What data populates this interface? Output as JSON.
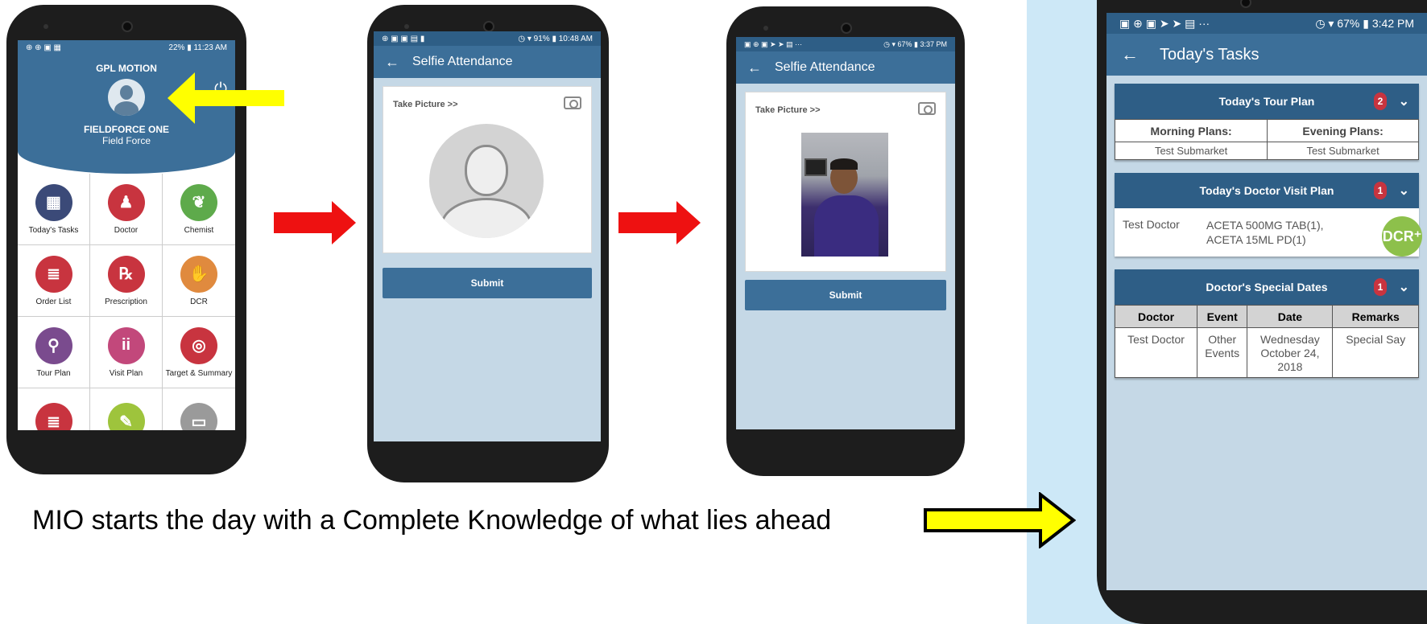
{
  "phone1": {
    "status_time": "11:23 AM",
    "status_battery": "22%",
    "app_title": "GPL MOTION",
    "user_name": "FIELDFORCE ONE",
    "user_role": "Field Force",
    "tiles": [
      {
        "label": "Today's Tasks",
        "icon": "calendar-icon",
        "color": "#3b4a78",
        "glyph": "▦"
      },
      {
        "label": "Doctor",
        "icon": "doctor-icon",
        "color": "#c8343f",
        "glyph": "♟"
      },
      {
        "label": "Chemist",
        "icon": "mortar-icon",
        "color": "#5eaa4b",
        "glyph": "❦"
      },
      {
        "label": "Order List",
        "icon": "order-list-icon",
        "color": "#c8343f",
        "glyph": "≣"
      },
      {
        "label": "Prescription",
        "icon": "prescription-icon",
        "color": "#c8343f",
        "glyph": "℞"
      },
      {
        "label": "DCR",
        "icon": "dcr-icon",
        "color": "#e08a3e",
        "glyph": "✋"
      },
      {
        "label": "Tour Plan",
        "icon": "map-pin-icon",
        "color": "#7a4b8e",
        "glyph": "⚲"
      },
      {
        "label": "Visit Plan",
        "icon": "visit-plan-icon",
        "color": "#c2487b",
        "glyph": "ii"
      },
      {
        "label": "Target & Summary",
        "icon": "target-icon",
        "color": "#c8343f",
        "glyph": "◎"
      },
      {
        "label": "",
        "icon": "list-icon",
        "color": "#c8343f",
        "glyph": "≣"
      },
      {
        "label": "",
        "icon": "notes-icon",
        "color": "#9ec43c",
        "glyph": "✎"
      },
      {
        "label": "",
        "icon": "presentation-icon",
        "color": "#9a9a9a",
        "glyph": "▭"
      }
    ]
  },
  "phone2": {
    "status_time": "10:48 AM",
    "status_battery": "91%",
    "title": "Selfie Attendance",
    "take_picture": "Take Picture >>",
    "submit": "Submit"
  },
  "phone3": {
    "status_time": "3:37 PM",
    "status_battery": "67%",
    "title": "Selfie Attendance",
    "take_picture": "Take Picture >>",
    "submit": "Submit"
  },
  "phone4": {
    "status_time": "3:42 PM",
    "status_battery": "67%",
    "title": "Today's Tasks",
    "tour_plan": {
      "header": "Today's Tour Plan",
      "badge": "2",
      "columns": [
        "Morning Plans:",
        "Evening Plans:"
      ],
      "values": [
        "Test Submarket",
        "Test Submarket"
      ]
    },
    "visit_plan": {
      "header": "Today's Doctor Visit Plan",
      "badge": "1",
      "doctor": "Test Doctor",
      "product_1": "ACETA  500MG TAB(1),",
      "product_2": "ACETA 15ML PD(1)",
      "dcr": "DCR⁺"
    },
    "special_dates": {
      "header": "Doctor's Special Dates",
      "badge": "1",
      "columns": [
        "Doctor",
        "Event",
        "Date",
        "Remarks"
      ],
      "row": {
        "doctor": "Test Doctor",
        "event_1": "Other",
        "event_2": "Events",
        "date_1": "Wednesday",
        "date_2": "October 24,",
        "date_3": "2018",
        "remarks": "Special Say"
      }
    }
  },
  "caption": "MIO starts the day with a Complete Knowledge of what lies ahead",
  "colors": {
    "accent_blue": "#3c6f99",
    "arrow_red": "#ee1111",
    "arrow_yellow": "#ffff00",
    "panel_blue": "#cde8f7"
  }
}
